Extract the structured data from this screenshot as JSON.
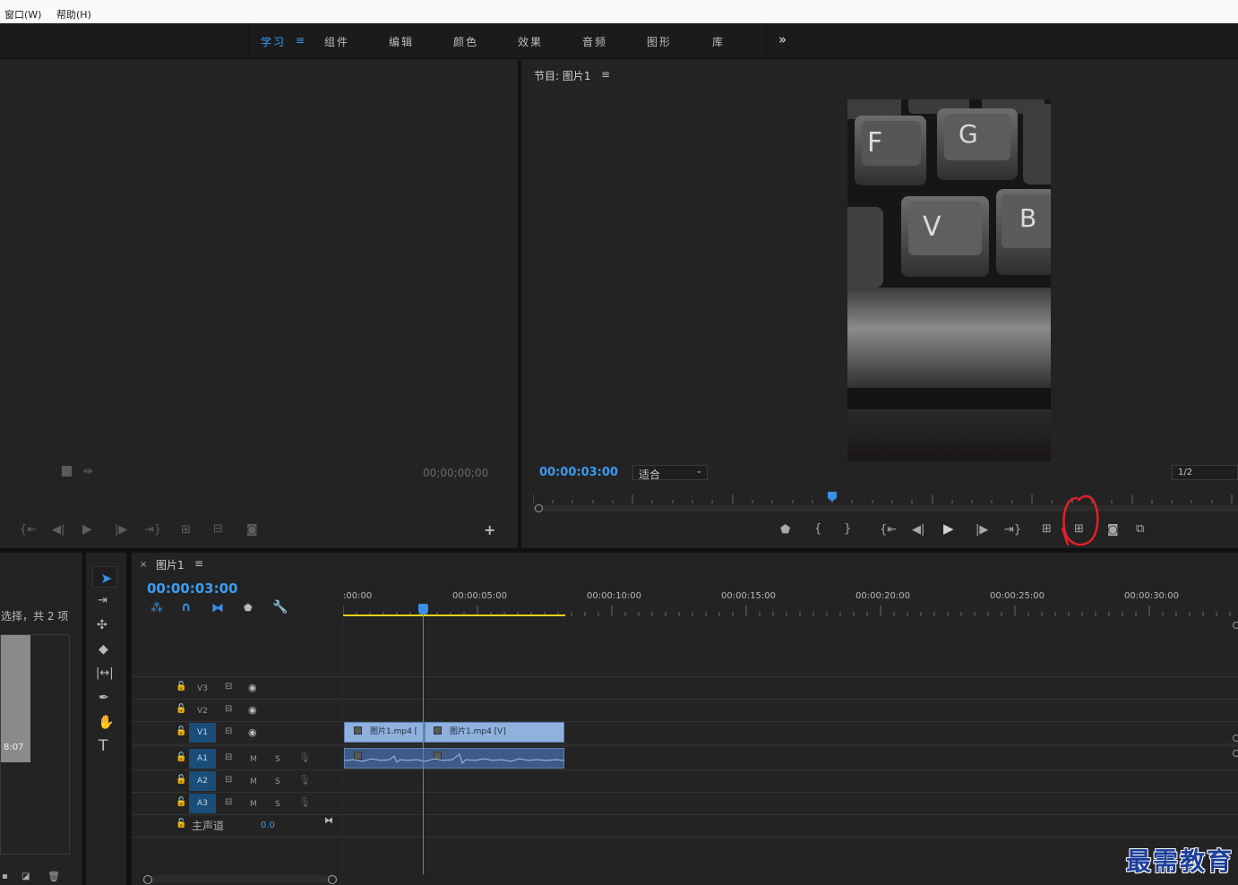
{
  "menubar": {
    "window": "窗口(W)",
    "help": "帮助(H)"
  },
  "workspaces": {
    "items": [
      {
        "label": "学习"
      },
      {
        "label": "组件"
      },
      {
        "label": "编辑"
      },
      {
        "label": "颜色"
      },
      {
        "label": "效果"
      },
      {
        "label": "音频"
      },
      {
        "label": "图形"
      },
      {
        "label": "库"
      }
    ],
    "menu_glyph": "≡",
    "more_glyph": "»"
  },
  "source_monitor": {
    "timecode": "00;00;00;00",
    "add_glyph": "+"
  },
  "program_monitor": {
    "title": "节目: 图片1",
    "menu_glyph": "≡",
    "timecode": "00:00:03:00",
    "fit_label": "适合",
    "resolution": "1/2"
  },
  "project_panel": {
    "selection_text": "选择，共 2 项",
    "thumb_duration": "8:07"
  },
  "timeline": {
    "sequence_name": "图片1",
    "close_glyph": "×",
    "menu_glyph": "≡",
    "timecode": "00:00:03:00",
    "ruler_labels": [
      ":00:00",
      "00:00:05:00",
      "00:00:10:00",
      "00:00:15:00",
      "00:00:20:00",
      "00:00:25:00",
      "00:00:30:00"
    ],
    "video_tracks": [
      "V3",
      "V2",
      "V1"
    ],
    "audio_tracks": [
      "A1",
      "A2",
      "A3"
    ],
    "mute_label": "M",
    "solo_label": "S",
    "master_label": "主声道",
    "master_value": "0.0",
    "clip_a_label": "图片1.mp4 [",
    "clip_b_label": "图片1.mp4 [V]"
  },
  "watermark": "最需教育",
  "colors": {
    "accent": "#3b9cf2",
    "clip": "#8fb1de",
    "work_area": "#e6d21c",
    "annotation": "#e0202a"
  }
}
